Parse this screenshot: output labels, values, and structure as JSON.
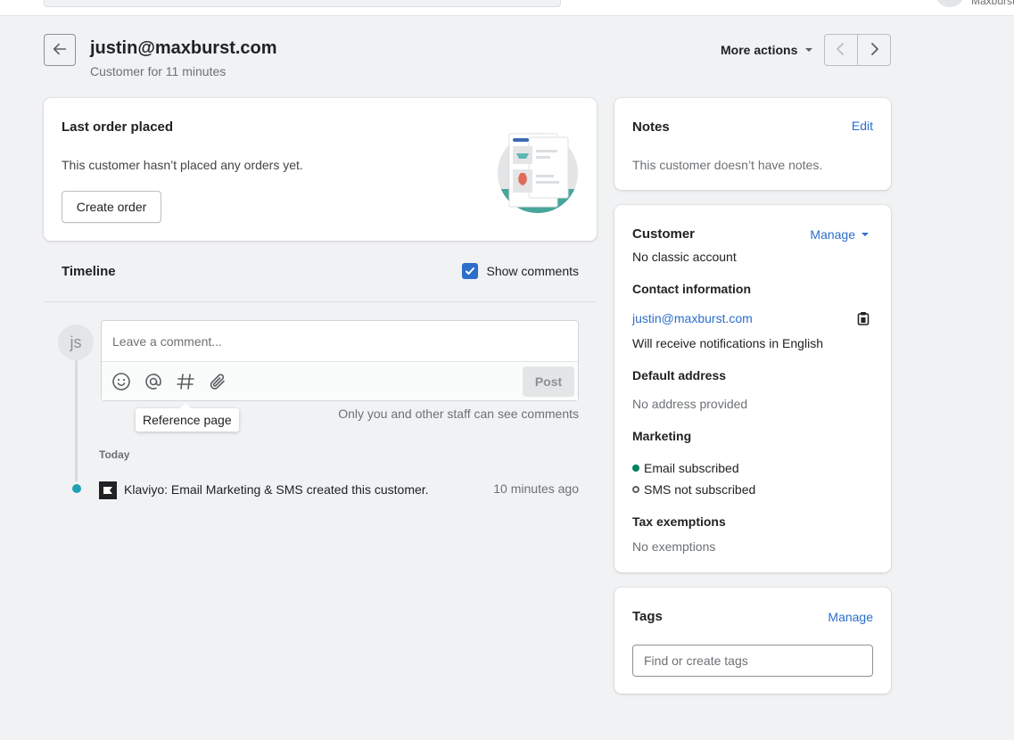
{
  "topbar": {
    "store_name": "Maxburst"
  },
  "header": {
    "title": "justin@maxburst.com",
    "subtitle": "Customer for 11 minutes",
    "more_actions": "More actions"
  },
  "last_order": {
    "title": "Last order placed",
    "description": "This customer hasn’t placed any orders yet.",
    "create_button": "Create order"
  },
  "timeline": {
    "title": "Timeline",
    "show_comments_label": "Show comments",
    "show_comments_checked": true,
    "avatar_initials": "js",
    "comment_placeholder": "Leave a comment...",
    "post_button": "Post",
    "tooltip": "Reference page",
    "staff_note": "Only you and other staff can see comments",
    "day_label": "Today",
    "events": [
      {
        "text": "Klaviyo: Email Marketing & SMS created this customer.",
        "time": "10 minutes ago"
      }
    ]
  },
  "notes": {
    "title": "Notes",
    "edit_label": "Edit",
    "description": "This customer doesn’t have notes."
  },
  "customer": {
    "title": "Customer",
    "manage_label": "Manage",
    "account_status": "No classic account",
    "contact_heading": "Contact information",
    "email": "justin@maxburst.com",
    "language_note": "Will receive notifications in English",
    "address_heading": "Default address",
    "address_value": "No address provided",
    "marketing_heading": "Marketing",
    "email_marketing": "Email subscribed",
    "sms_marketing": "SMS not subscribed",
    "tax_heading": "Tax exemptions",
    "tax_value": "No exemptions"
  },
  "tags": {
    "title": "Tags",
    "manage_label": "Manage",
    "placeholder": "Find or create tags"
  },
  "colors": {
    "accent": "#2c6ecb",
    "timeline_dot": "#1fa0b3",
    "subscribed": "#007f5f",
    "background": "#f1f2f3"
  }
}
